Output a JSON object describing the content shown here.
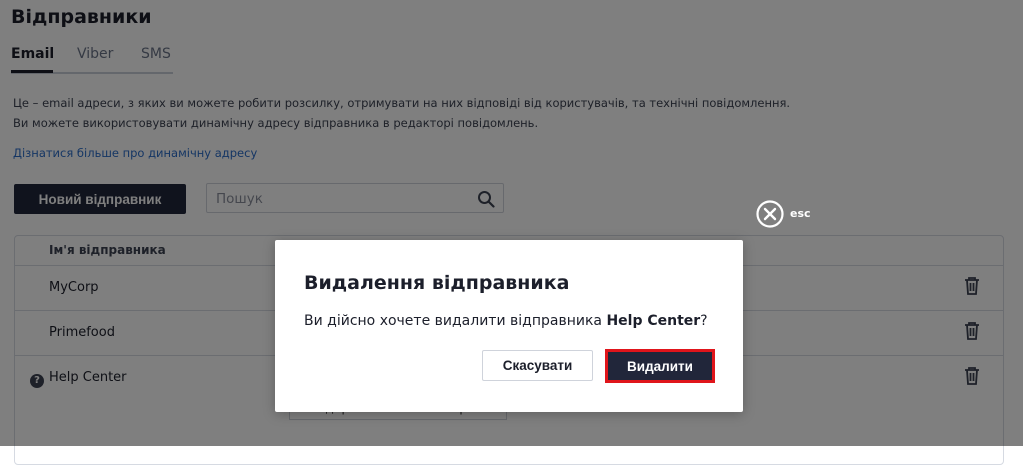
{
  "page": {
    "title": "Відправники",
    "tabs": [
      {
        "label": "Email",
        "active": true
      },
      {
        "label": "Viber",
        "active": false
      },
      {
        "label": "SMS",
        "active": false
      }
    ],
    "description_line1": "Це – email адреси, з яких ви можете робити розсилку, отримувати на них відповіді від користувачів, та технічні повідомлення.",
    "description_line2": "Ви можете використовувати динамічну адресу відправника в редакторі повідомлень.",
    "learn_more_link": "Дізнатися більше про динамічну адресу",
    "new_sender_button": "Новий відправник",
    "search": {
      "placeholder": "Пошук",
      "value": ""
    }
  },
  "table": {
    "column_header": "Ім'я відправника",
    "rows": [
      {
        "name": "MyCorp"
      },
      {
        "name": "Primefood"
      },
      {
        "name": "Help Center",
        "action_button": "Відправити лист повторно"
      }
    ]
  },
  "modal": {
    "close_label": "esc",
    "title": "Видалення відправника",
    "text_before": "Ви дійсно хочете видалити відправника ",
    "sender_name": "Help Center",
    "text_after": "?",
    "cancel_button": "Скасувати",
    "delete_button": "Видалити"
  },
  "colors": {
    "primary_button": "#21263a",
    "link": "#2a6cc9",
    "highlight_border": "#e0151b",
    "overlay": "rgba(0,0,0,0.5)"
  }
}
